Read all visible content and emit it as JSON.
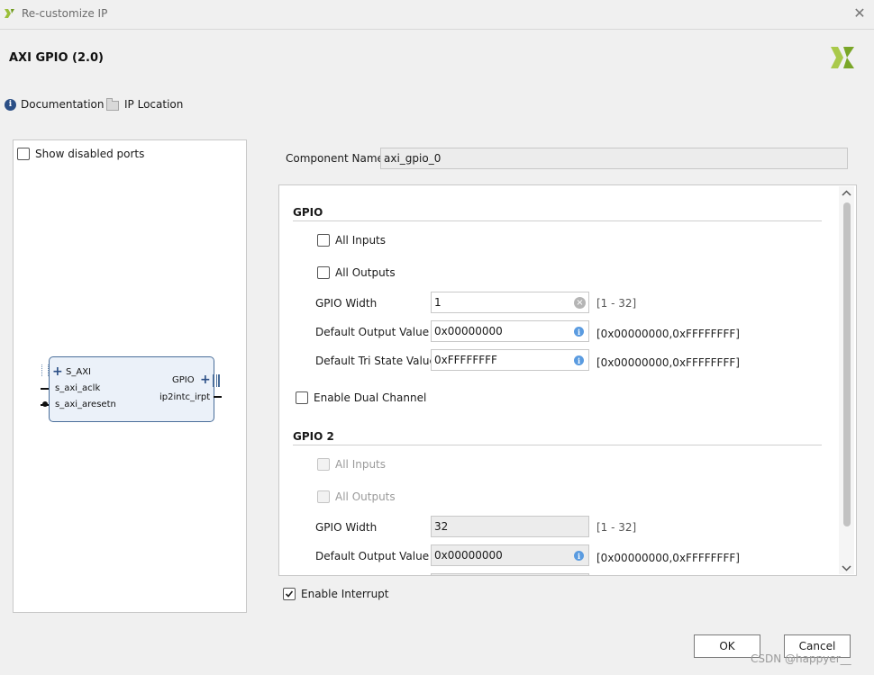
{
  "window": {
    "title": "Re-customize IP",
    "close_glyph": "✕"
  },
  "header": {
    "ip_title": "AXI GPIO (2.0)",
    "logo_icon": "xilinx-logo"
  },
  "toolbar": {
    "documentation_label": "Documentation",
    "ip_location_label": "IP Location"
  },
  "left_panel": {
    "show_disabled_ports_label": "Show disabled ports",
    "show_disabled_ports_checked": false,
    "block": {
      "left_ports": [
        "S_AXI",
        "s_axi_aclk",
        "s_axi_aresetn"
      ],
      "right_ports": [
        "GPIO",
        "ip2intc_irpt"
      ]
    }
  },
  "component": {
    "label": "Component Name",
    "value": "axi_gpio_0"
  },
  "gpio": {
    "title": "GPIO",
    "all_inputs_label": "All Inputs",
    "all_outputs_label": "All Outputs",
    "width_label": "GPIO Width",
    "width_value": "1",
    "width_range": "[1 - 32]",
    "default_output_label": "Default Output Value",
    "default_output_value": "0x00000000",
    "default_output_range": "[0x00000000,0xFFFFFFFF]",
    "default_tri_label": "Default Tri State Value",
    "default_tri_value": "0xFFFFFFFF",
    "default_tri_range": "[0x00000000,0xFFFFFFFF]"
  },
  "dual_channel_label": "Enable Dual Channel",
  "gpio2": {
    "title": "GPIO 2",
    "all_inputs_label": "All Inputs",
    "all_outputs_label": "All Outputs",
    "width_label": "GPIO Width",
    "width_value": "32",
    "width_range": "[1 - 32]",
    "default_output_label": "Default Output Value",
    "default_output_value": "0x00000000",
    "default_output_range": "[0x00000000,0xFFFFFFFF]"
  },
  "interrupt": {
    "label": "Enable Interrupt",
    "checked": true
  },
  "buttons": {
    "ok": "OK",
    "cancel": "Cancel"
  },
  "watermark": "CSDN @happyer__",
  "colors": {
    "accent_blue": "#2b4f86",
    "block_fill": "#ebf1f9",
    "info_blue": "#5a9be0"
  }
}
